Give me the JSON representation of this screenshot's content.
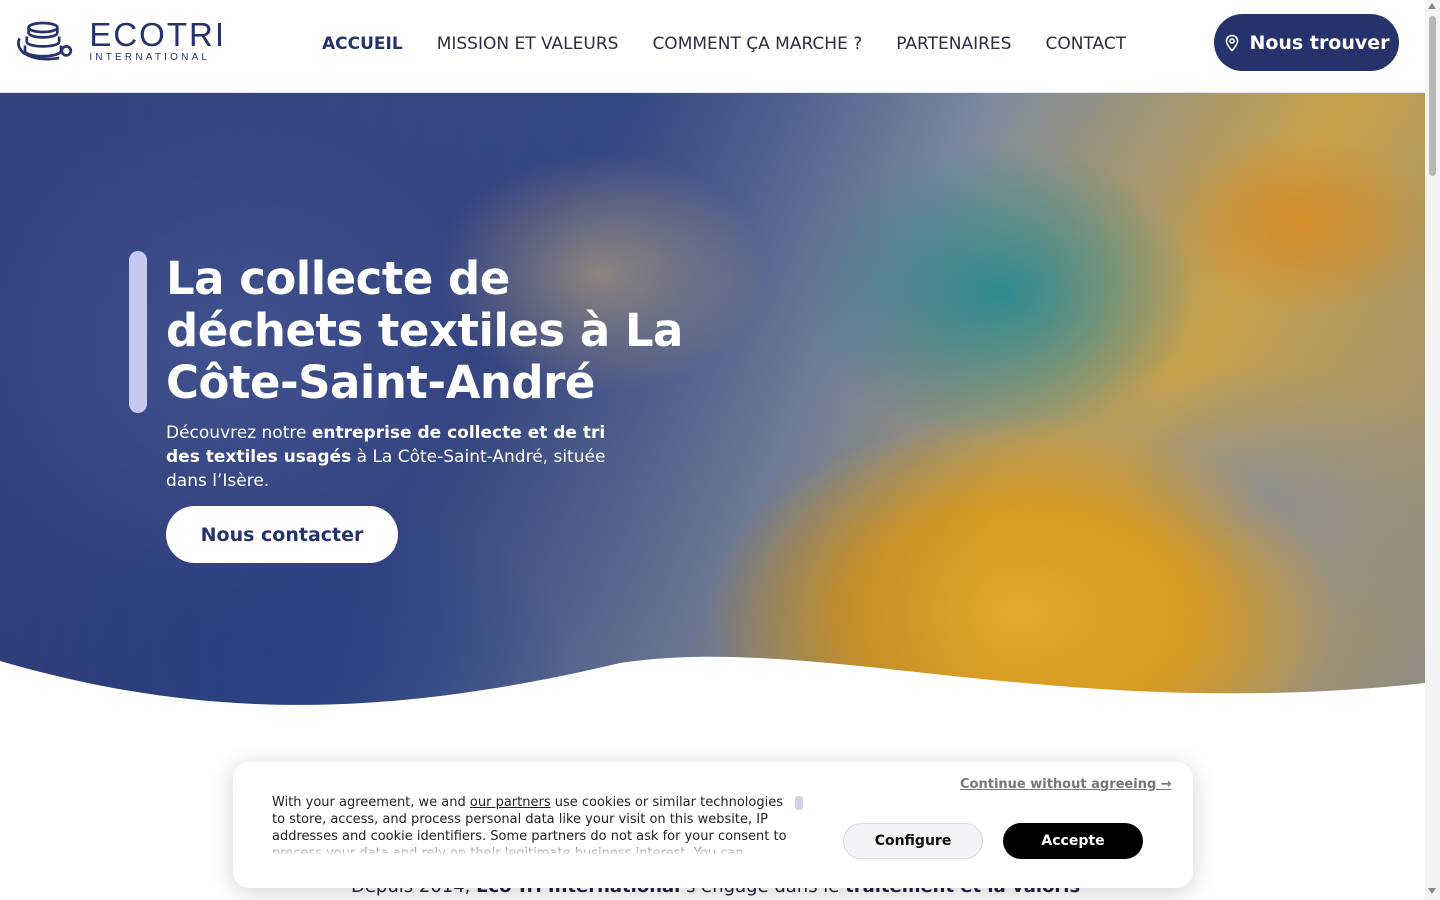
{
  "brand": {
    "name": "ECOTRI",
    "subtitle": "INTERNATIONAL",
    "color": "#26326b"
  },
  "nav": {
    "items": [
      {
        "label": "ACCUEIL",
        "active": true
      },
      {
        "label": "MISSION ET VALEURS",
        "active": false
      },
      {
        "label": "COMMENT ÇA MARCHE ?",
        "active": false
      },
      {
        "label": "PARTENAIRES",
        "active": false
      },
      {
        "label": "CONTACT",
        "active": false
      }
    ],
    "find_button": {
      "label": "Nous trouver",
      "icon": "map-pin-icon"
    }
  },
  "hero": {
    "title": "La collecte de déchets textiles à La Côte-Saint-André",
    "desc_part1": "Découvrez notre ",
    "desc_bold1": "entreprise de collecte et de tri des textiles usagés",
    "desc_part2": " à La Côte-Saint-André, située dans l’Isère.",
    "cta_label": "Nous contacter"
  },
  "intro": {
    "part1": "Depuis 2014, ",
    "bold1": "Eco-Tri International",
    "part2": " s’engage dans le ",
    "bold2": "traitement et la valorisation des"
  },
  "cookie": {
    "text_before_link": "With your agreement, we and ",
    "link_label": "our partners",
    "text_after_link": " use cookies or similar technologies to store, access, and process personal data like your visit on this website, IP addresses and cookie identifiers. Some partners do not ask for your consent to process your data and rely on their legitimate business interest. You can",
    "continue_label": "Continue without agreeing →",
    "configure_label": "Configure",
    "accept_label": "Accepte"
  }
}
